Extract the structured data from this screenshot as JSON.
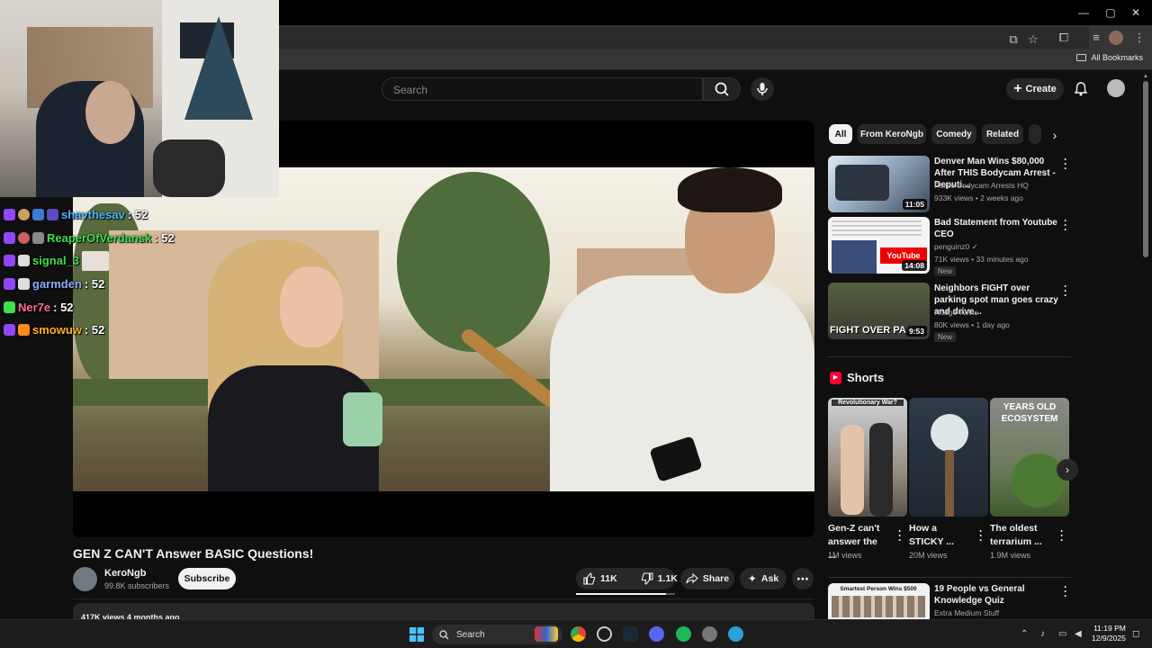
{
  "window": {
    "minimize": "—",
    "maximize": "▢",
    "close": "✕"
  },
  "bookmarks": {
    "all_bookmarks": "All Bookmarks"
  },
  "header": {
    "search_placeholder": "Search",
    "create_label": "Create"
  },
  "chat": {
    "lines": [
      {
        "user": "shavthesav",
        "msg": ": 52",
        "color": "#4fb7ff"
      },
      {
        "user": "ReaperOfVerdansk",
        "msg": ": 52",
        "color": "#3ee04e"
      },
      {
        "user": "signal_3",
        "msg": "",
        "color": "#3ee04e"
      },
      {
        "user": "garmden",
        "msg": ": 52",
        "color": "#8fa8ff"
      },
      {
        "user": "Ner7e",
        "msg": ": 52",
        "color": "#ff6b9b"
      },
      {
        "user": "smowuw",
        "msg": ": 52",
        "color": "#ffb020"
      }
    ]
  },
  "video": {
    "title": "GEN Z CAN'T Answer BASIC Questions!",
    "channel": "KeroNgb",
    "subscribers": "99.8K subscribers",
    "subscribe_label": "Subscribe",
    "likes": "11K",
    "dislikes": "1.1K",
    "share_label": "Share",
    "ask_label": "Ask",
    "like_ratio": 0.91,
    "description_meta": "417K views  4 months ago"
  },
  "chips": [
    "All",
    "From KeroNgb",
    "Comedy",
    "Related"
  ],
  "recommendations": [
    {
      "title": "Denver Man Wins $80,000 After THIS Bodycam Arrest - Deputi...",
      "channel": "Police Bodycam Arrests HQ",
      "meta": "933K views • 2 weeks ago",
      "duration": "11:05",
      "badge": ""
    },
    {
      "title": "Bad Statement from Youtube CEO",
      "channel": "penguinz0 ✓",
      "meta": "71K views • 33 minutes ago",
      "duration": "14:08",
      "badge": "New"
    },
    {
      "title": "Neighbors FIGHT over parking spot man goes crazy and drive...",
      "channel": "Hodge Twins",
      "meta": "80K views • 1 day ago",
      "duration": "9:53",
      "badge": "New"
    }
  ],
  "thumb_texts": {
    "rec3": "FIGHT OVER PARK",
    "rec2_brand": "YouTube"
  },
  "shorts": {
    "heading": "Shorts",
    "items": [
      {
        "title": "Gen-Z can't answer the ...",
        "views": "1M views",
        "overlay": "Revolutionary War?"
      },
      {
        "title": "How a STICKY ...",
        "views": "20M views",
        "overlay": ""
      },
      {
        "title": "The oldest terrarium ...",
        "views": "1.9M views",
        "overlay": "YEARS OLD ECOSYSTEM"
      }
    ]
  },
  "bottom_rec": {
    "title": "19 People vs General Knowledge Quiz",
    "channel": "Extra Medium Stuff",
    "thumb_text": "Smartest Person Wins $500"
  },
  "taskbar": {
    "search": "Search",
    "time": "11:19 PM",
    "date": "12/9/2025"
  }
}
